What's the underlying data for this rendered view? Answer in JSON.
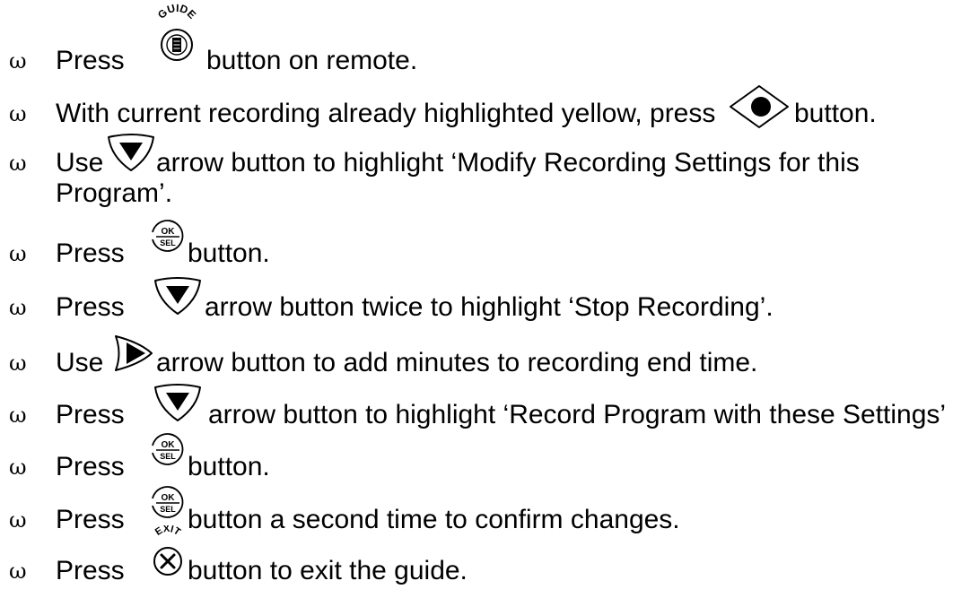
{
  "bullet": "ω",
  "steps": [
    {
      "a": "Press",
      "icon": "guide-button-icon",
      "icon_label": "GUIDE",
      "b": "button on remote."
    },
    {
      "a": "With current recording already highlighted yellow, press",
      "icon": "record-button-icon",
      "b": "button."
    },
    {
      "a": "Use",
      "icon": "down-arrow-button-icon",
      "b": "arrow button to highlight ‘Modify Recording Settings for this",
      "b2": "Program’."
    },
    {
      "a": "Press",
      "icon": "ok-sel-button-icon",
      "b": "button."
    },
    {
      "a": "Press",
      "icon": "down-arrow-button-icon",
      "b": "arrow button twice to highlight ‘Stop Recording’."
    },
    {
      "a": "Use",
      "icon": "right-arrow-button-icon",
      "b": "arrow button to add minutes to recording end time."
    },
    {
      "a": "Press",
      "icon": "down-arrow-button-icon",
      "b": "arrow button to highlight ‘Record Program with these Settings’"
    },
    {
      "a": "Press",
      "icon": "ok-sel-button-icon",
      "b": "button."
    },
    {
      "a": "Press",
      "icon": "ok-sel-button-icon",
      "b": "button a second time to confirm changes."
    },
    {
      "a": "Press",
      "icon": "exit-button-icon",
      "icon_label": "EXIT",
      "b": "button to exit the guide."
    }
  ],
  "ok_sel": {
    "top": "OK",
    "bottom": "SEL"
  }
}
